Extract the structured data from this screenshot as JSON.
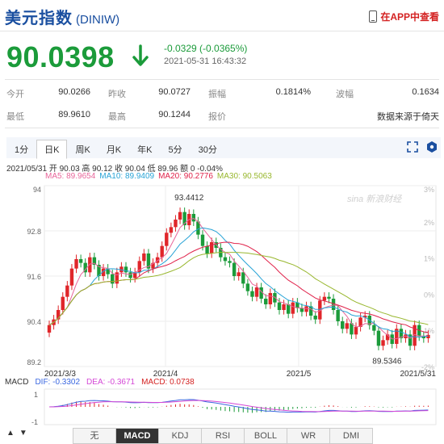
{
  "header": {
    "title": "美元指数",
    "code": "(DINIW)",
    "app_link": "在APP中查看"
  },
  "quote": {
    "price": "90.0398",
    "change": "-0.0329 (-0.0365%)",
    "time": "2021-05-31 16:43:32",
    "color_down": "#1b9b3a"
  },
  "stats": {
    "row1": [
      {
        "label": "今开",
        "value": "90.0266"
      },
      {
        "label": "昨收",
        "value": "90.0727"
      },
      {
        "label": "振幅",
        "value": "0.1814%"
      },
      {
        "label": "波幅",
        "value": "0.1634"
      }
    ],
    "row2": [
      {
        "label": "最低",
        "value": "89.9610"
      },
      {
        "label": "最高",
        "value": "90.1244"
      },
      {
        "label": "报价",
        "value": ""
      },
      {
        "label": "",
        "value": "数据来源于倚天"
      }
    ]
  },
  "period_tabs": [
    "1分",
    "日K",
    "周K",
    "月K",
    "年K",
    "5分",
    "30分"
  ],
  "active_period": 1,
  "ohlc_line": "2021/05/31 开 90.03 高 90.12 收 90.04 低 89.96 额 0 -0.04%",
  "ma_legend": [
    {
      "label": "MA5: 89.9654",
      "color": "#e8659a"
    },
    {
      "label": "MA10: 89.9409",
      "color": "#27a3d6"
    },
    {
      "label": "MA20: 90.2776",
      "color": "#e0224a"
    },
    {
      "label": "MA30: 90.5063",
      "color": "#98b72e"
    }
  ],
  "chart_data": {
    "type": "candlestick",
    "y_axis_left": [
      "94",
      "92.8",
      "91.6",
      "90.4",
      "89.2"
    ],
    "y_axis_right": [
      "3%",
      "2%",
      "1%",
      "0%",
      "-1%",
      "-2%"
    ],
    "x_labels": [
      "2021/3/3",
      "2021/4",
      "2021/5",
      "2021/5/31"
    ],
    "ylim": [
      89.2,
      94.0
    ],
    "annotations": [
      {
        "text": "93.4412",
        "value": 93.4412
      },
      {
        "text": "89.5346",
        "value": 89.5346
      }
    ],
    "watermark": "sina 新浪财经",
    "closes": [
      90.3,
      90.45,
      90.7,
      91.05,
      91.35,
      91.8,
      92.05,
      91.95,
      91.7,
      92.1,
      91.9,
      91.6,
      91.8,
      91.65,
      91.4,
      91.7,
      91.85,
      91.7,
      91.55,
      91.7,
      92.0,
      92.2,
      91.8,
      91.95,
      92.1,
      92.4,
      92.75,
      92.9,
      93.1,
      93.3,
      92.95,
      93.25,
      93.05,
      92.7,
      92.4,
      92.2,
      92.5,
      92.35,
      92.1,
      92.0,
      91.95,
      91.6,
      91.7,
      91.4,
      91.2,
      91.05,
      91.3,
      91.0,
      90.85,
      91.15,
      90.9,
      90.7,
      90.85,
      90.6,
      90.9,
      90.75,
      90.65,
      90.8,
      90.55,
      90.45,
      90.95,
      91.05,
      91.0,
      90.7,
      90.4,
      90.2,
      90.35,
      90.05,
      90.25,
      90.5,
      90.55,
      90.3,
      90.15,
      89.75,
      89.9,
      90.05,
      89.8,
      90.2,
      89.95,
      90.05,
      89.75,
      90.3,
      90.0,
      89.95,
      90.04
    ],
    "macd": {
      "dif_label": "DIF: -0.3302",
      "dea_label": "DEA: -0.3671",
      "macd_label": "MACD: 0.0738",
      "y_labels": [
        "1",
        "-1"
      ],
      "dif_color": "#3a67e0",
      "dea_color": "#d447d6"
    }
  },
  "indicator_tabs": [
    "无",
    "MACD",
    "KDJ",
    "RSI",
    "BOLL",
    "WR",
    "DMI"
  ],
  "active_indicator": 1,
  "nav": {
    "prev": "▲",
    "next": "▼"
  }
}
